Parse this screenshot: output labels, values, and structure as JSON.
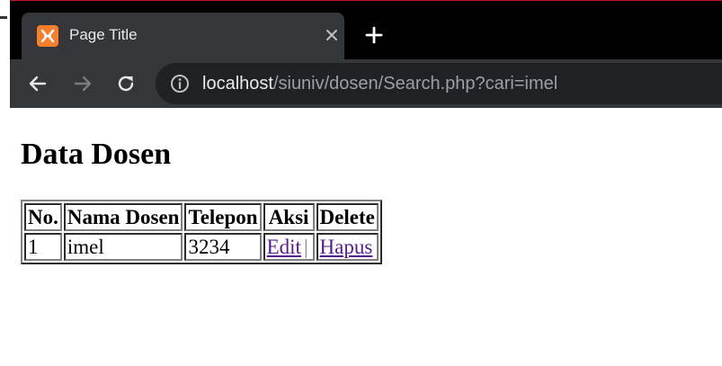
{
  "browser": {
    "tab": {
      "title": "Page Title"
    },
    "url": {
      "host": "localhost",
      "path": "/siuniv/dosen/Search.php?cari=imel"
    }
  },
  "page": {
    "title": "Data Dosen",
    "table": {
      "headers": [
        "No.",
        "Nama Dosen",
        "Telepon",
        "Aksi",
        "Delete"
      ],
      "rows": [
        {
          "no": "1",
          "nama": "imel",
          "telepon": "3234",
          "edit_label": "Edit",
          "separator": "|",
          "hapus_label": "Hapus"
        }
      ]
    }
  },
  "colors": {
    "tab_bar": "#000000",
    "toolbar": "#35363a",
    "omnibox": "#202124",
    "favicon": "#f57f2a",
    "visited_link": "#551a8b"
  }
}
